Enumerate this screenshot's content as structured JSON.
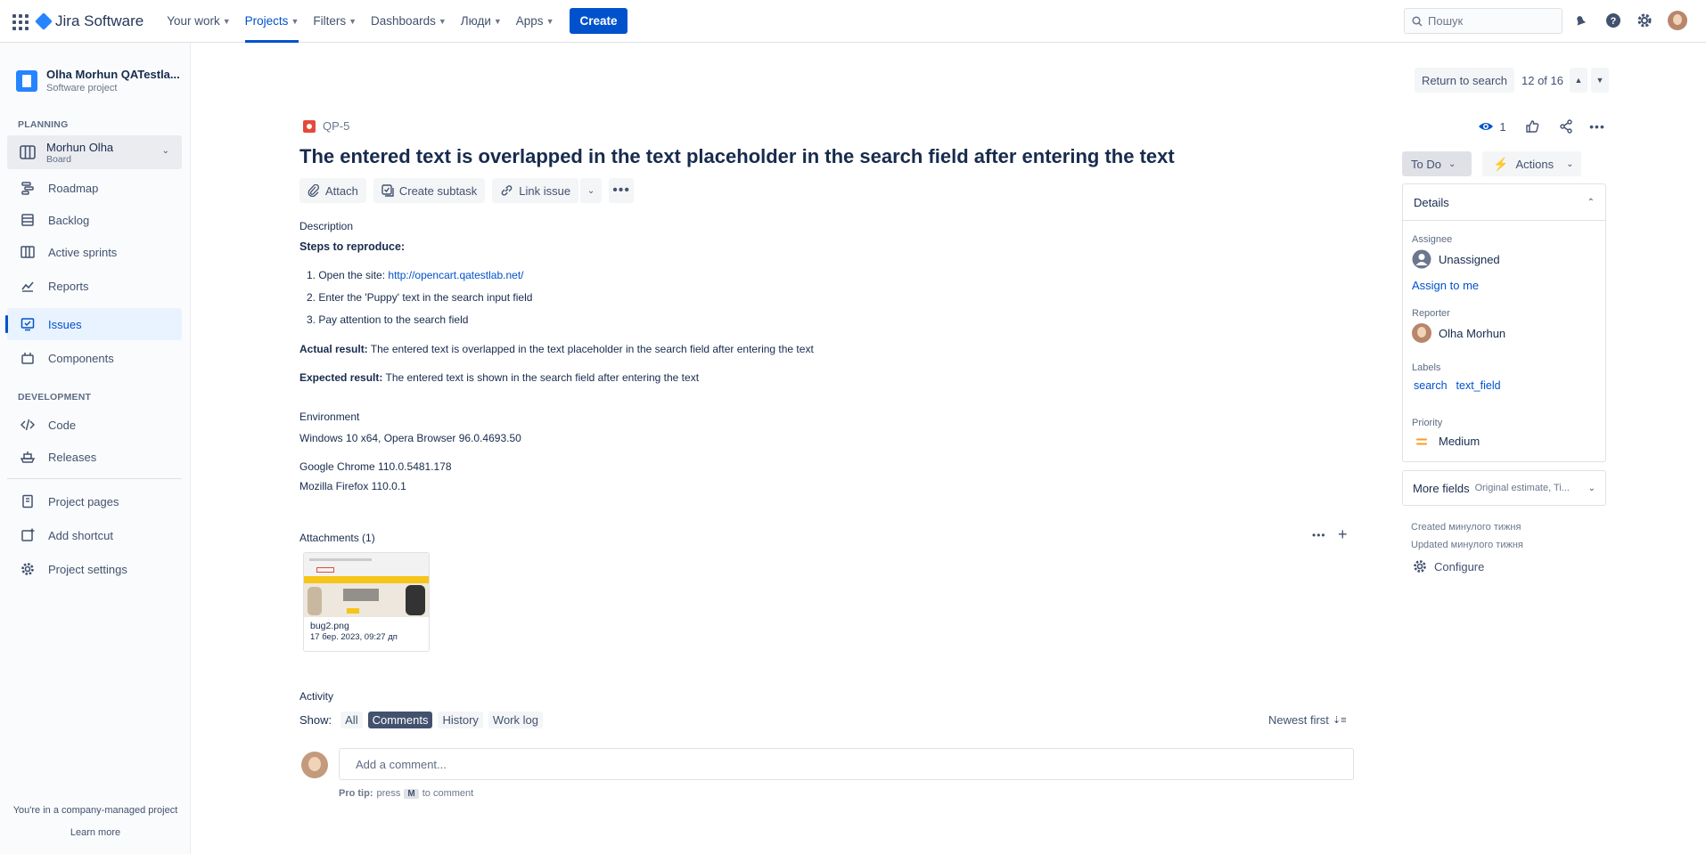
{
  "topnav": {
    "brand": "Jira Software",
    "items": [
      {
        "label": "Your work"
      },
      {
        "label": "Projects"
      },
      {
        "label": "Filters"
      },
      {
        "label": "Dashboards"
      },
      {
        "label": "Люди"
      },
      {
        "label": "Apps"
      }
    ],
    "create_label": "Create",
    "search_placeholder": "Пошук"
  },
  "sidebar": {
    "project_name": "Olha Morhun QATestla...",
    "project_type": "Software project",
    "planning_title": "PLANNING",
    "board_name": "Morhun Olha",
    "board_sub": "Board",
    "planning_items": [
      {
        "label": "Roadmap"
      },
      {
        "label": "Backlog"
      },
      {
        "label": "Active sprints"
      },
      {
        "label": "Reports"
      }
    ],
    "issues_label": "Issues",
    "components_label": "Components",
    "development_title": "DEVELOPMENT",
    "code_label": "Code",
    "releases_label": "Releases",
    "project_pages_label": "Project pages",
    "add_shortcut_label": "Add shortcut",
    "project_settings_label": "Project settings",
    "footer_text": "You're in a company-managed project",
    "learn_more": "Learn more"
  },
  "issue": {
    "key": "QP-5",
    "title": "The entered text is overlapped in the text placeholder in the search field after entering the text",
    "toolbar": {
      "attach": "Attach",
      "create_subtask": "Create subtask",
      "link_issue": "Link issue"
    },
    "description_heading": "Description",
    "steps_heading": "Steps to reproduce:",
    "step1_prefix": "Open the site: ",
    "step1_link": "http://opencart.qatestlab.net/",
    "step2": "Enter the 'Puppy' text in the search input field",
    "step3": "Pay attention to the search field",
    "actual_label": "Actual result:",
    "actual_text": " The entered text is overlapped in the text placeholder in the search field after entering the text",
    "expected_label": "Expected result:",
    "expected_text": " The entered text is shown in the search field after entering the text",
    "environment_heading": "Environment",
    "env_line1": "Windows 10 x64, Opera Browser 96.0.4693.50",
    "env_line2": "Google Chrome 110.0.5481.178",
    "env_line3": "Mozilla Firefox 110.0.1",
    "attachments_heading": "Attachments (1)",
    "attachment": {
      "name": "bug2.png",
      "date": "17 бер. 2023, 09:27 дп"
    },
    "activity_heading": "Activity",
    "show_label": "Show:",
    "activity_tabs": [
      "All",
      "Comments",
      "History",
      "Work log"
    ],
    "newest_first": "Newest first",
    "comment_placeholder": "Add a comment...",
    "protip_bold": "Pro tip:",
    "protip_press": "press",
    "protip_key": "M",
    "protip_rest": "to comment"
  },
  "right_panel": {
    "return_to_search": "Return to search",
    "position": "12 of 16",
    "watch_count": "1",
    "status": "To Do",
    "actions": "Actions",
    "details_heading": "Details",
    "assignee_label": "Assignee",
    "assignee_value": "Unassigned",
    "assign_to_me": "Assign to me",
    "reporter_label": "Reporter",
    "reporter_value": "Olha Morhun",
    "labels_label": "Labels",
    "labels": [
      "search",
      "text_field"
    ],
    "priority_label": "Priority",
    "priority_value": "Medium",
    "more_fields": "More fields",
    "more_fields_hint": "Original estimate, Ti...",
    "created": "Created минулого тижня",
    "updated": "Updated минулого тижня",
    "configure": "Configure"
  },
  "colors": {
    "accent": "#0052CC",
    "priority_medium": "#FF991F",
    "bug": "#E5493A"
  }
}
